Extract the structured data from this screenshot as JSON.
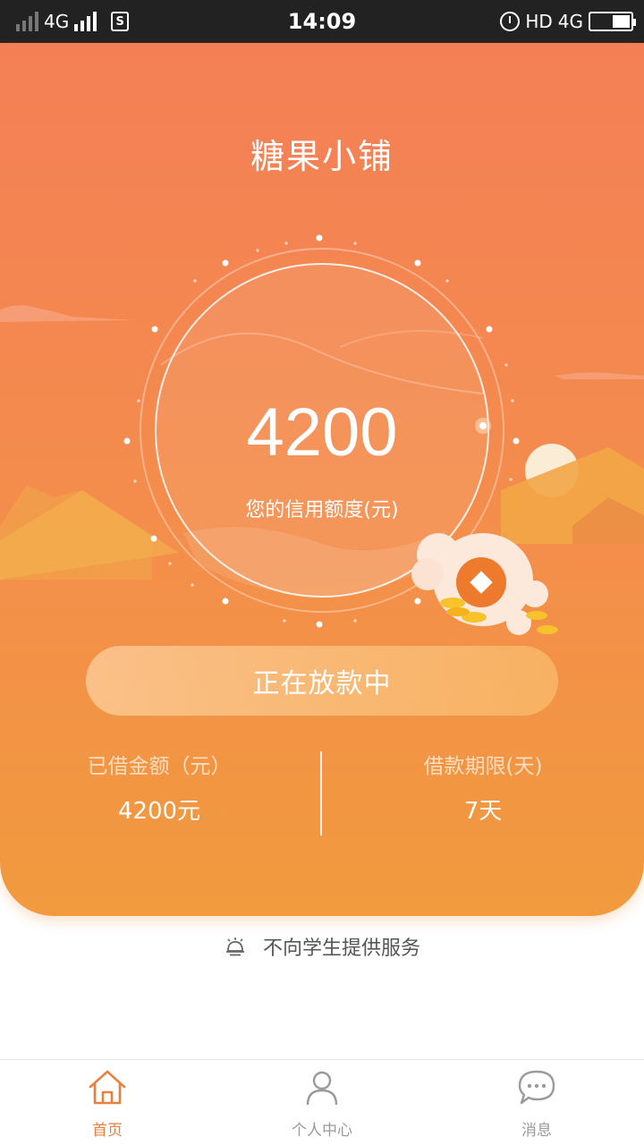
{
  "status_bar": {
    "network_1": "4G",
    "time": "14:09",
    "hd": "HD",
    "network_2": "4G",
    "sim_glyph": "S"
  },
  "app": {
    "title": "糖果小铺"
  },
  "credit": {
    "amount": "4200",
    "label": "您的信用额度(元)"
  },
  "loan_status_button": {
    "label": "正在放款中"
  },
  "stats": {
    "borrowed_label": "已借金额（元）",
    "borrowed_value": "4200元",
    "term_label": "借款期限(天)",
    "term_value": "7天"
  },
  "notice": {
    "text": "不向学生提供服务",
    "icon": "bell-icon"
  },
  "tabbar": {
    "items": [
      {
        "label": "首页",
        "icon": "home-icon",
        "active": true
      },
      {
        "label": "个人中心",
        "icon": "person-icon",
        "active": false
      },
      {
        "label": "消息",
        "icon": "chat-icon",
        "active": false
      }
    ]
  },
  "colors": {
    "accent": "#e8803f",
    "hero_top": "#f47f56",
    "hero_bottom": "#f19a3e"
  }
}
